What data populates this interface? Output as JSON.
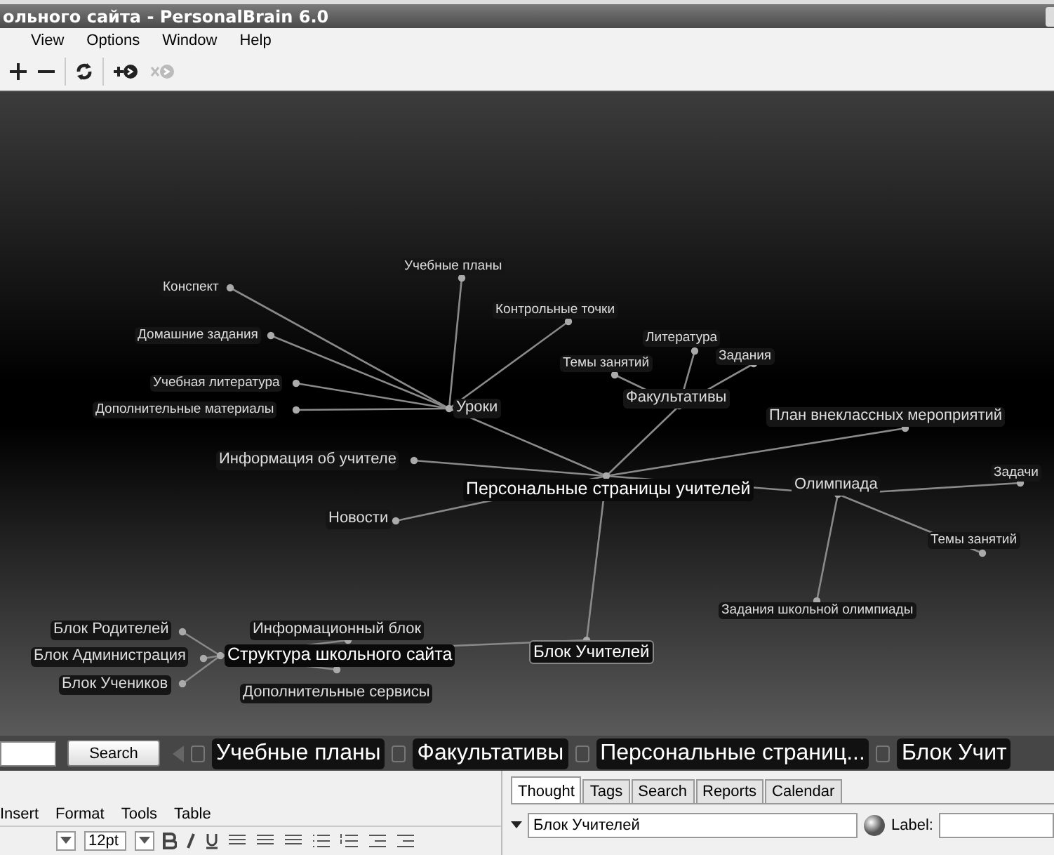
{
  "window": {
    "title": "ольного сайта - PersonalBrain 6.0"
  },
  "menu": [
    {
      "label": "View"
    },
    {
      "label": "Options"
    },
    {
      "label": "Window"
    },
    {
      "label": "Help"
    }
  ],
  "toolbar": [
    {
      "kind": "plus",
      "disabled": false
    },
    {
      "kind": "minus",
      "disabled": false
    },
    {
      "kind": "refresh",
      "disabled": false
    },
    {
      "kind": "link-add",
      "disabled": false
    },
    {
      "kind": "link-remove",
      "disabled": true
    }
  ],
  "graph": {
    "root": {
      "label": "Персональные страницы учителей",
      "kind": "large",
      "children": [
        {
          "label": "Уроки",
          "kind": "medium",
          "children": [
            {
              "label": "Конспект",
              "kind": "small"
            },
            {
              "label": "Домашние задания",
              "kind": "small"
            },
            {
              "label": "Учебная литература",
              "kind": "small"
            },
            {
              "label": "Дополнительные материалы",
              "kind": "small"
            },
            {
              "label": "Учебные планы",
              "kind": "small"
            },
            {
              "label": "Контрольные точки",
              "kind": "small"
            }
          ]
        },
        {
          "label": "Факультативы",
          "kind": "medium",
          "children": [
            {
              "label": "Темы занятий",
              "kind": "small"
            },
            {
              "label": "Литература",
              "kind": "small"
            },
            {
              "label": "Задания",
              "kind": "small"
            }
          ]
        },
        {
          "label": "План внеклассных мероприятий",
          "kind": "medium"
        },
        {
          "label": "Олимпиада",
          "kind": "medium",
          "children": [
            {
              "label": "Задачи",
              "kind": "small"
            },
            {
              "label": "Темы занятий",
              "kind": "small"
            },
            {
              "label": "Задания школьной олимпиады",
              "kind": "small"
            }
          ]
        },
        {
          "label": "Информация об учителе",
          "kind": "medium"
        },
        {
          "label": "Новости",
          "kind": "medium"
        },
        {
          "label": "Блок Учителей",
          "kind": "active",
          "children": [
            {
              "label": "Структура школьного сайта",
              "kind": "large",
              "children": [
                {
                  "label": "Блок Родителей",
                  "kind": "medium"
                },
                {
                  "label": "Блок Администрация",
                  "kind": "medium"
                },
                {
                  "label": "Блок Учеников",
                  "kind": "medium"
                },
                {
                  "label": "Информационный блок",
                  "kind": "medium"
                },
                {
                  "label": "Дополнительные сервисы",
                  "kind": "medium"
                }
              ]
            }
          ]
        }
      ]
    }
  },
  "search": {
    "button": "Search"
  },
  "breadcrumbs": [
    {
      "label": "Учебные планы"
    },
    {
      "label": "Факультативы"
    },
    {
      "label": "Персональные страниц..."
    },
    {
      "label": "Блок Учит"
    }
  ],
  "editor": {
    "menu": [
      "Insert",
      "Format",
      "Tools",
      "Table"
    ],
    "font_size": "12pt"
  },
  "thought_panel": {
    "tabs": [
      {
        "label": "Thought",
        "selected": true
      },
      {
        "label": "Tags",
        "selected": false
      },
      {
        "label": "Search",
        "selected": false
      },
      {
        "label": "Reports",
        "selected": false
      },
      {
        "label": "Calendar",
        "selected": false
      }
    ],
    "name": "Блок Учителей",
    "label_caption": "Label:"
  }
}
